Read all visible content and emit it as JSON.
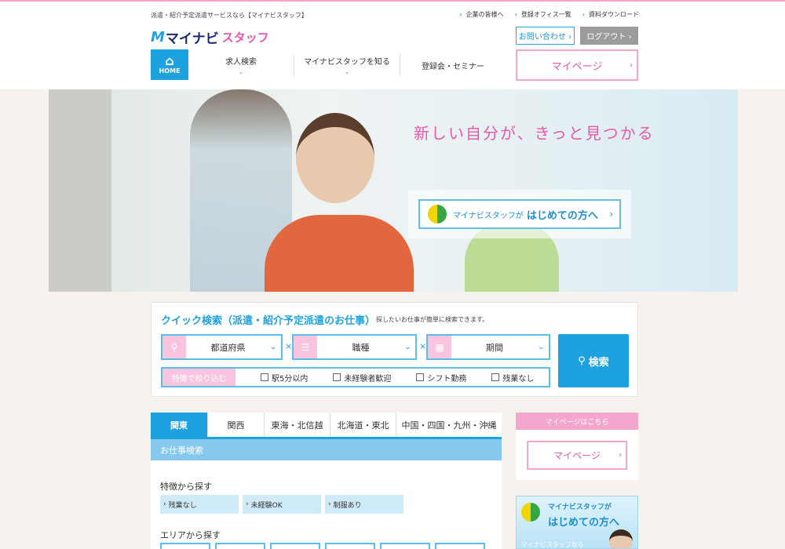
{
  "header": {
    "tagline": "派遣・紹介予定派遣サービスなら【マイナビスタッフ】",
    "top_links": [
      "企業の皆様へ",
      "登録オフィス一覧",
      "資料ダウンロード"
    ],
    "logo": {
      "mark": "M",
      "text1": "マイナビ",
      "text2": "スタッフ"
    },
    "contact_label": "お問い合わせ ›",
    "logout_label": "ログアウト ›",
    "home_label": "HOME",
    "nav": [
      "求人検索",
      "マイナビスタッフを知る",
      "登録会・セミナー"
    ],
    "mypage_label": "マイページ"
  },
  "hero": {
    "catch": "新しい自分が、きっと見つかる",
    "button_pre": "マイナビスタッフが",
    "button_main": "はじめての方へ"
  },
  "quick_search": {
    "title": "クイック検索（派遣・紹介予定派遣のお仕事）",
    "subtitle": "探したいお仕事が簡単に検索できます。",
    "selects": [
      {
        "label": "都道府県",
        "icon": "map-pin-icon"
      },
      {
        "label": "職種",
        "icon": "list-icon"
      },
      {
        "label": "期間",
        "icon": "calendar-icon"
      }
    ],
    "filter_label": "特徴で絞り込む",
    "checkboxes": [
      "駅5分以内",
      "未経験者歓迎",
      "シフト勤務",
      "残業なし"
    ],
    "search_label": "検索"
  },
  "region_tabs": [
    "関東",
    "関西",
    "東海・北信越",
    "北海道・東北",
    "中国・四国・九州・沖縄"
  ],
  "panel": {
    "header": "お仕事検索",
    "feature_heading": "特徴から探す",
    "features": [
      "残業なし",
      "未経験OK",
      "制服あり"
    ],
    "area_heading": "エリアから探す"
  },
  "sidebar": {
    "mypage_header": "マイページはこちら",
    "mypage_label": "マイページ",
    "banner_line1": "マイナビスタッフが",
    "banner_line2": "はじめての方へ",
    "banner_line3": "マイナビスタッフなら"
  },
  "colors": {
    "brand_blue": "#1ea2df",
    "brand_pink": "#e85aa7",
    "light_pink": "#f4a6cc"
  }
}
